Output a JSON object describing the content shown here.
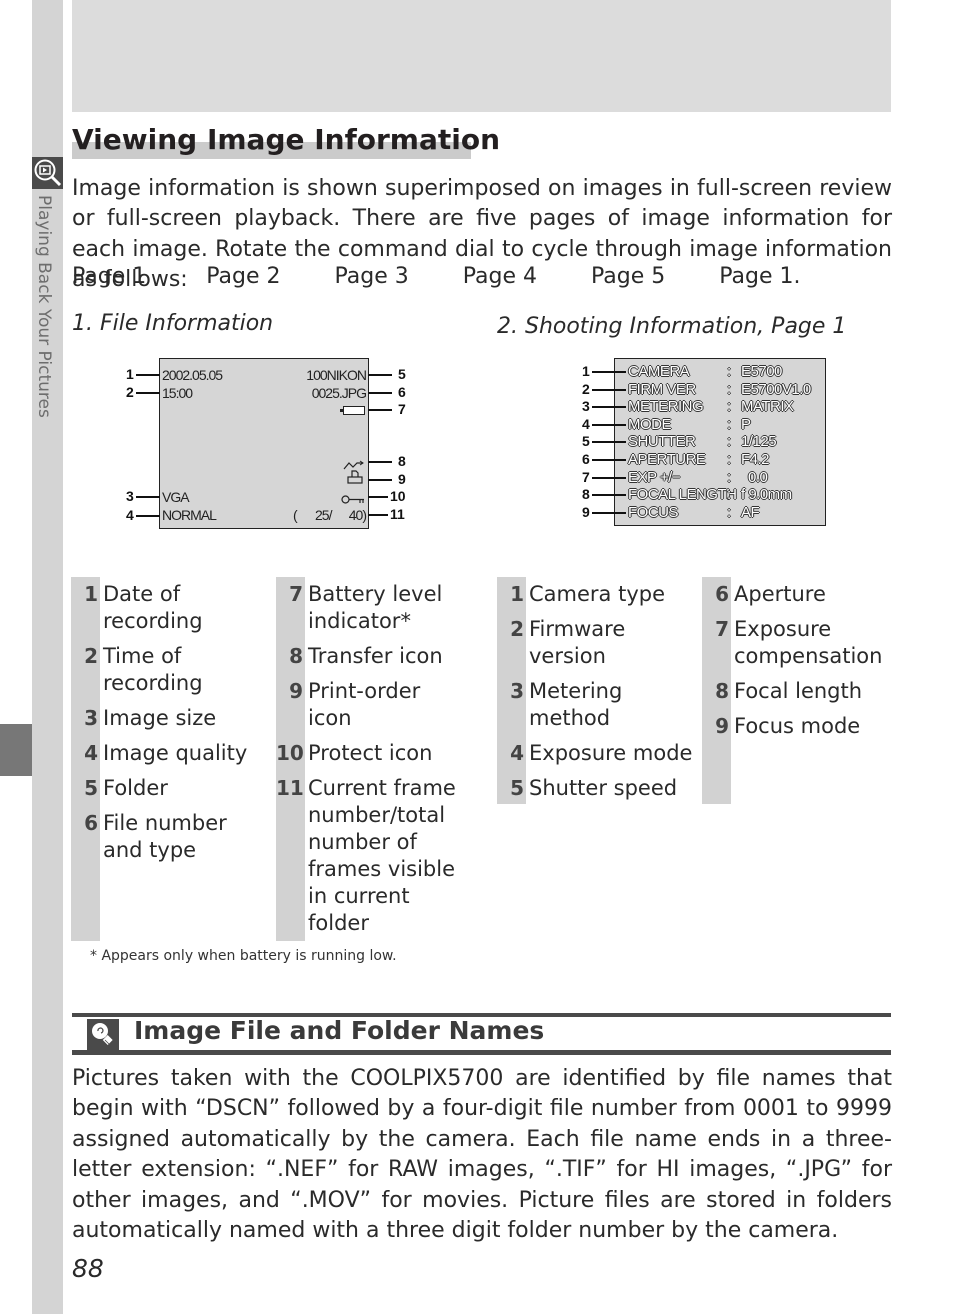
{
  "side_tab": {
    "label": "Playing Back Your Pictures",
    "icon": "playback-zoom-icon"
  },
  "title": "Viewing Image Information",
  "intro": "Image information is shown superimposed on images in full-screen review or full-screen playback. There are five pages of image information for each image. Rotate the command dial to cycle through image information as follows:",
  "page_cycle": [
    "Page 1",
    "Page 2",
    "Page 3",
    "Page 4",
    "Page 5",
    "Page 1."
  ],
  "section1": {
    "heading": "1. File Information",
    "screen": {
      "date": "2002.05.05",
      "time": "15:00",
      "folder": "100NIKON",
      "file": "0025.JPG",
      "size": "VGA",
      "quality": "NORMAL",
      "frame_open": "(",
      "frame_current": "25/",
      "frame_total": "40)",
      "icons": [
        "battery-icon",
        "transfer-icon",
        "print-order-icon",
        "protect-key-icon"
      ]
    },
    "callouts": [
      "1",
      "2",
      "3",
      "4",
      "5",
      "6",
      "7",
      "8",
      "9",
      "10",
      "11"
    ],
    "legend_left": [
      {
        "num": "1",
        "text": "Date of recording"
      },
      {
        "num": "2",
        "text": "Time of recording"
      },
      {
        "num": "3",
        "text": "Image size"
      },
      {
        "num": "4",
        "text": "Image quality"
      },
      {
        "num": "5",
        "text": "Folder"
      },
      {
        "num": "6",
        "text": "File number and type"
      }
    ],
    "legend_right": [
      {
        "num": "7",
        "text": "Battery level indicator*"
      },
      {
        "num": "8",
        "text": "Transfer icon"
      },
      {
        "num": "9",
        "text": "Print-order icon"
      },
      {
        "num": "10",
        "text": "Protect icon"
      },
      {
        "num": "11",
        "text": "Current frame number/total number of frames visible in current folder"
      }
    ],
    "footnote": "*  Appears only when battery is running low."
  },
  "section2": {
    "heading": "2. Shooting Information, Page 1",
    "rows": [
      {
        "num": "1",
        "label": "CAMERA",
        "value": "E5700"
      },
      {
        "num": "2",
        "label": "FIRM VER",
        "value": "E5700V1.0"
      },
      {
        "num": "3",
        "label": "METERING",
        "value": "MATRIX"
      },
      {
        "num": "4",
        "label": "MODE",
        "value": "P"
      },
      {
        "num": "5",
        "label": "SHUTTER",
        "value": "1/125"
      },
      {
        "num": "6",
        "label": "APERTURE",
        "value": "F4.2"
      },
      {
        "num": "7",
        "label": "EXP +/−",
        "value": "0.0"
      },
      {
        "num": "8",
        "label": "FOCAL LENGTH",
        "value": "f 9.0mm"
      },
      {
        "num": "9",
        "label": "FOCUS",
        "value": "AF"
      }
    ],
    "separator": ":",
    "legend_left": [
      {
        "num": "1",
        "text": "Camera type"
      },
      {
        "num": "2",
        "text": "Firmware version"
      },
      {
        "num": "3",
        "text": "Metering method"
      },
      {
        "num": "4",
        "text": "Exposure mode"
      },
      {
        "num": "5",
        "text": "Shutter speed"
      }
    ],
    "legend_right": [
      {
        "num": "6",
        "text": "Aperture"
      },
      {
        "num": "7",
        "text": "Exposure compensation"
      },
      {
        "num": "8",
        "text": "Focal length"
      },
      {
        "num": "9",
        "text": "Focus mode"
      }
    ]
  },
  "tip": {
    "icon": "lightbulb-tip-icon",
    "title": "Image File and Folder Names",
    "body": "Pictures taken with the COOLPIX5700 are identified by file names that begin with “DSCN” followed by a four-digit file number from 0001 to 9999 assigned automatically by the camera.  Each file name ends in a three-letter extension: “.NEF” for RAW images, “.TIF” for HI images, “.JPG” for other images, and “.MOV” for movies.  Picture files are stored in folders automatically named with a three digit folder number by the camera."
  },
  "page_number": "88"
}
